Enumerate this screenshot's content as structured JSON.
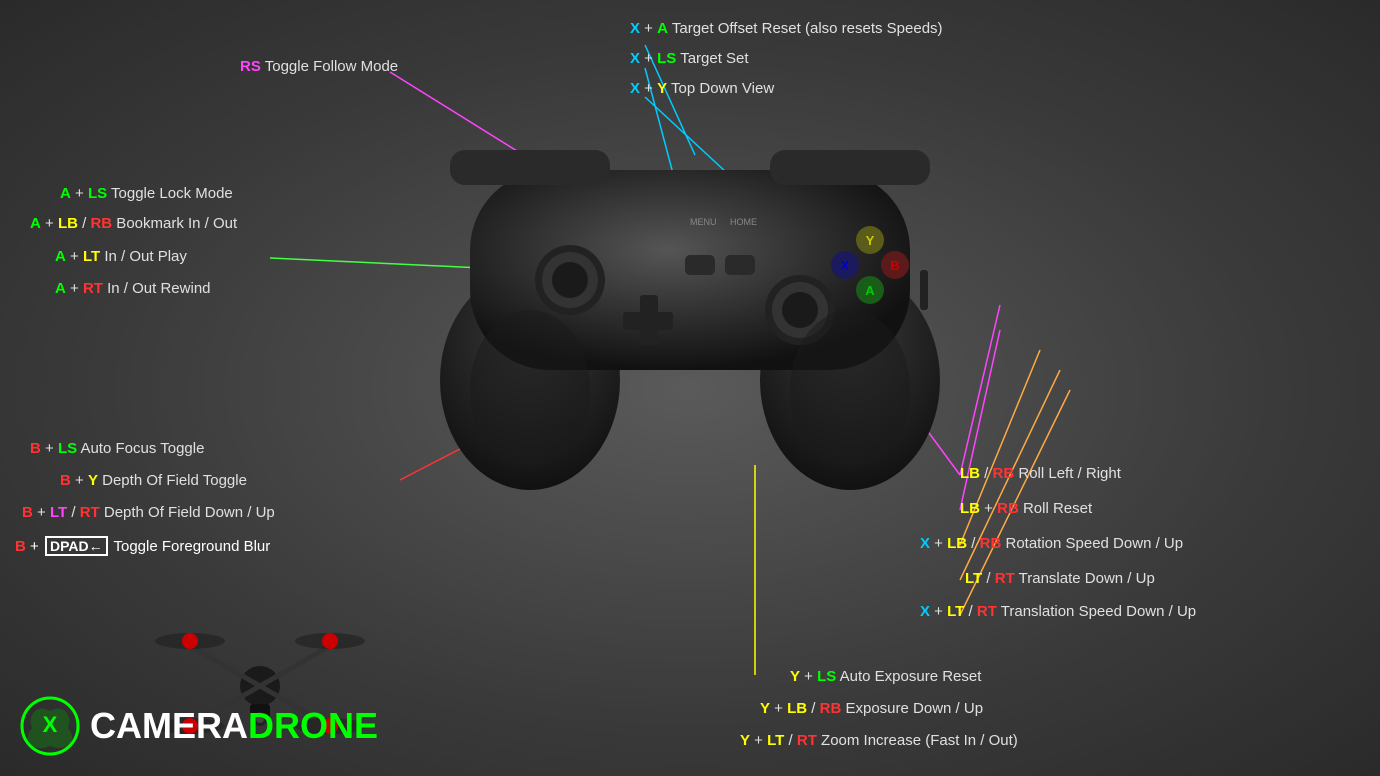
{
  "labels": {
    "rs_toggle": {
      "text_key": "RS",
      "text_rest": " Toggle Follow Mode",
      "key_color": "magenta"
    },
    "x_a": {
      "text_key": "X",
      "text_plus": " + ",
      "text_key2": "A",
      "text_rest": " Target Offset Reset (also resets Speeds)",
      "key_color": "cyan",
      "key_color2": "green"
    },
    "x_ls": {
      "text_key": "X",
      "text_plus": " + ",
      "text_key2": "LS",
      "text_rest": " Target Set",
      "key_color": "cyan",
      "key_color2": "green"
    },
    "x_y": {
      "text_key": "X",
      "text_plus": " + ",
      "text_key2": "Y",
      "text_rest": " Top Down View",
      "key_color": "cyan",
      "key_color2": "yellow"
    },
    "a_ls": {
      "text_key": "A",
      "text_plus": " + ",
      "text_key2": "LS",
      "text_rest": " Toggle Lock Mode",
      "key_color": "green",
      "key_color2": "green"
    },
    "a_lb_rb": {
      "text_key": "A",
      "text_plus": " + ",
      "text_key2": "LB",
      "text_sep": " / ",
      "text_key3": "RB",
      "text_rest": " Bookmark In / Out",
      "key_color": "green",
      "key_color2": "yellow",
      "key_color3": "red"
    },
    "a_lt": {
      "text_key": "A",
      "text_plus": " + ",
      "text_key2": "LT",
      "text_rest": " In / Out Play",
      "key_color": "green",
      "key_color2": "yellow"
    },
    "a_rt": {
      "text_key": "A",
      "text_plus": " + ",
      "text_key2": "RT",
      "text_rest": " In / Out Rewind",
      "key_color": "green",
      "key_color2": "red"
    },
    "b_ls": {
      "text_key": "B",
      "text_plus": " + ",
      "text_key2": "LS",
      "text_rest": " Auto Focus Toggle",
      "key_color": "red",
      "key_color2": "green"
    },
    "b_y": {
      "text_key": "B",
      "text_plus": " + ",
      "text_key2": "Y",
      "text_rest": " Depth Of Field Toggle",
      "key_color": "red",
      "key_color2": "yellow"
    },
    "b_lt_rt": {
      "text_key": "B",
      "text_plus": " + ",
      "text_key2": "LT",
      "text_sep": " / ",
      "text_key3": "RT",
      "text_rest": " Depth Of Field Down / Up",
      "key_color": "red",
      "key_color2": "magenta",
      "key_color3": "red"
    },
    "b_dpad": {
      "text_key": "B",
      "text_plus": " + ",
      "text_key2": "DPAD←",
      "text_rest": " Toggle Foreground Blur",
      "key_color": "red"
    },
    "lb_rb": {
      "text_key": "LB",
      "text_sep": " / ",
      "text_key2": "RB",
      "text_rest": " Roll Left / Right",
      "key_color": "yellow",
      "key_color2": "red"
    },
    "lb_plus_rb": {
      "text_key": "LB",
      "text_plus": " + ",
      "text_key2": "RB",
      "text_rest": " Roll Reset",
      "key_color": "yellow",
      "key_color2": "red"
    },
    "x_lb_rb": {
      "text_key": "X",
      "text_plus": " + ",
      "text_key2": "LB",
      "text_sep": " / ",
      "text_key3": "RB",
      "text_rest": " Rotation Speed Down / Up",
      "key_color": "cyan",
      "key_color2": "yellow",
      "key_color3": "red"
    },
    "lt_rt": {
      "text_key": "LT",
      "text_sep": " / ",
      "text_key2": "RT",
      "text_rest": " Translate Down / Up",
      "key_color": "yellow",
      "key_color2": "red"
    },
    "x_lt_rt": {
      "text_key": "X",
      "text_plus": " + ",
      "text_key2": "LT",
      "text_sep": " / ",
      "text_key3": "RT",
      "text_rest": " Translation Speed Down / Up",
      "key_color": "cyan",
      "key_color2": "yellow",
      "key_color3": "red"
    },
    "y_ls": {
      "text_key": "Y",
      "text_plus": " + ",
      "text_key2": "LS",
      "text_rest": " Auto Exposure Reset",
      "key_color": "yellow",
      "key_color2": "green"
    },
    "y_lb_rb": {
      "text_key": "Y",
      "text_plus": " + ",
      "text_key2": "LB",
      "text_sep": " / ",
      "text_key3": "RB",
      "text_rest": " Exposure Down / Up",
      "key_color": "yellow",
      "key_color2": "yellow",
      "key_color3": "red"
    },
    "y_lt_rt": {
      "text_key": "Y",
      "text_plus": " + ",
      "text_key2": "LT",
      "text_sep": " / ",
      "text_key3": "RT",
      "text_rest": " Zoom Increase (Fast In / Out)",
      "key_color": "yellow",
      "key_color2": "yellow",
      "key_color3": "red"
    }
  },
  "logo": {
    "camera": "CAMERA",
    "drone": "DRONE",
    "camera_color": "#ffffff",
    "drone_color": "#00ff00"
  }
}
